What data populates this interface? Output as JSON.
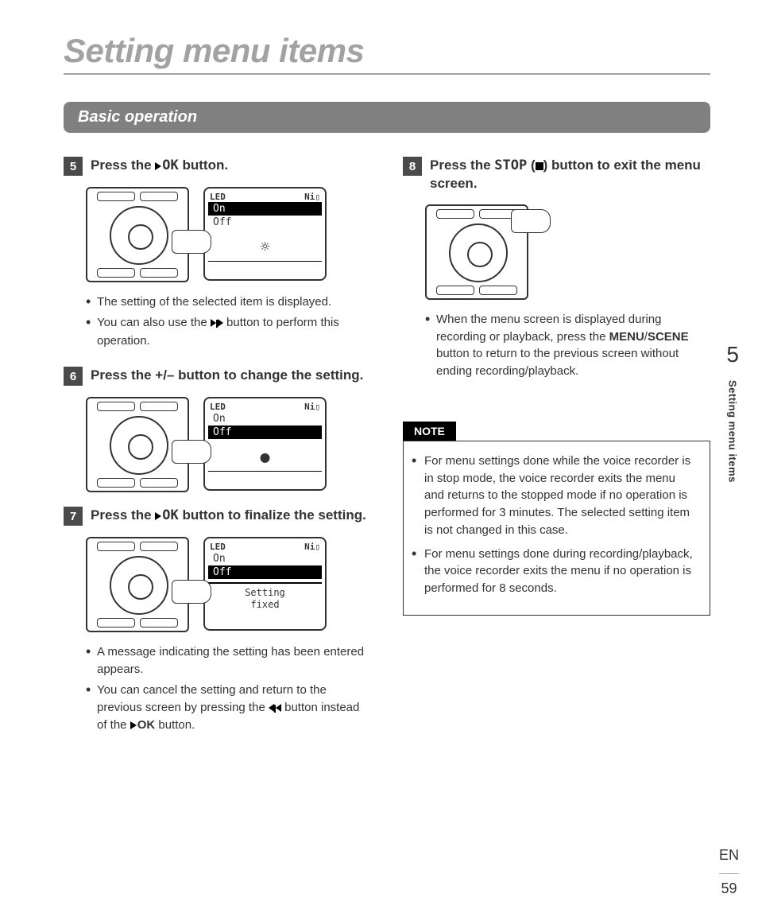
{
  "page": {
    "title": "Setting menu items",
    "section": "Basic operation",
    "lang": "EN",
    "number": "59",
    "chapter": "5",
    "side_label": "Setting menu items"
  },
  "steps": {
    "s5": {
      "num": "5",
      "text_a": "Press the ",
      "ok": "OK",
      "text_b": " button.",
      "b1": "The setting of the selected item is displayed.",
      "b2a": "You can also use the ",
      "b2b": " button to perform this operation."
    },
    "s6": {
      "num": "6",
      "text": "Press the +/– button to change the setting."
    },
    "s7": {
      "num": "7",
      "text_a": "Press the ",
      "ok": "OK",
      "text_b": " button to finalize the setting.",
      "b1": "A message indicating the setting has been entered appears.",
      "b2a": "You can cancel the setting and return to the previous screen by pressing the ",
      "b2b": " button instead of the ",
      "ok2": "OK",
      "b2c": " button."
    },
    "s8": {
      "num": "8",
      "text_a": "Press the ",
      "stop": "STOP",
      "text_b": " (",
      "text_c": ") button to exit the menu screen.",
      "b1a": "When the menu screen is displayed during recording or playback, press the ",
      "menu": "MENU",
      "slash": "/",
      "scene": "SCENE",
      "b1b": " button to return to the previous screen without ending recording/playback."
    }
  },
  "lcd": {
    "hdr_left": "LED",
    "hdr_right": "Ni▯",
    "on": "On",
    "off": "Off",
    "msg1": "Setting",
    "msg2": "fixed"
  },
  "note": {
    "label": "NOTE",
    "n1": "For menu settings done while the voice recorder is in stop mode, the voice recorder exits the menu and returns to the stopped mode if no operation is performed for 3 minutes. The selected setting item is not changed in this case.",
    "n2": "For menu settings done during recording/playback, the voice recorder exits the menu if no operation is performed for 8 seconds."
  }
}
